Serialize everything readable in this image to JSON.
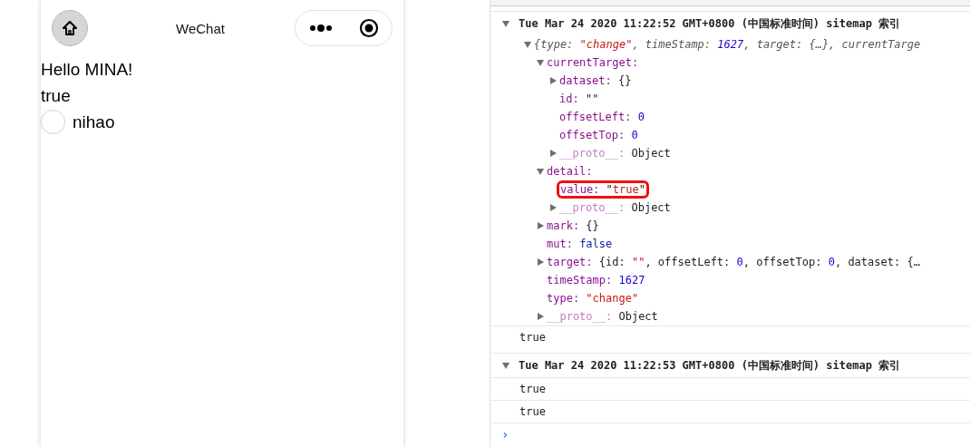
{
  "simulator": {
    "nav_bar": {
      "title": "WeChat"
    },
    "content": [
      {
        "kind": "text",
        "text": "Hello MINA!"
      },
      {
        "kind": "text",
        "text": "true"
      },
      {
        "kind": "radio",
        "label": "nihao",
        "checked": false
      }
    ]
  },
  "console": {
    "entries": [
      {
        "kind": "group",
        "expanded": true,
        "text": "Tue Mar 24 2020 11:22:52 GMT+0800 (中国标准时间) sitemap 索引",
        "children": [
          {
            "kind": "object",
            "expanded": true,
            "tokens": [
              {
                "kind": "plain",
                "text": "{type: "
              },
              {
                "kind": "string",
                "text": "\"change\""
              },
              {
                "kind": "plain",
                "text": ", timeStamp: "
              },
              {
                "kind": "number",
                "text": "1627"
              },
              {
                "kind": "plain",
                "text": ", target: {…}, currentTarge"
              }
            ],
            "children": [
              {
                "expanded": true,
                "tokens": [
                  {
                    "kind": "key",
                    "text": "currentTarget:"
                  }
                ],
                "children": [
                  {
                    "expanded": false,
                    "tokens": [
                      {
                        "kind": "key",
                        "text": "dataset:"
                      },
                      {
                        "kind": "plain",
                        "text": " {}"
                      }
                    ]
                  },
                  {
                    "tokens": [
                      {
                        "kind": "key",
                        "text": "id:"
                      },
                      {
                        "kind": "plain",
                        "text": " \"\""
                      }
                    ]
                  },
                  {
                    "tokens": [
                      {
                        "kind": "key",
                        "text": "offsetLeft:"
                      },
                      {
                        "kind": "number",
                        "text": " 0"
                      }
                    ]
                  },
                  {
                    "tokens": [
                      {
                        "kind": "key",
                        "text": "offsetTop:"
                      },
                      {
                        "kind": "number",
                        "text": " 0"
                      }
                    ]
                  },
                  {
                    "expanded": false,
                    "tokens": [
                      {
                        "kind": "proto",
                        "text": "__proto__:"
                      },
                      {
                        "kind": "plain",
                        "text": " Object"
                      }
                    ]
                  }
                ]
              },
              {
                "expanded": true,
                "tokens": [
                  {
                    "kind": "key",
                    "text": "detail:"
                  }
                ],
                "children": [
                  {
                    "highlighted": true,
                    "tokens": [
                      {
                        "kind": "key",
                        "text": "value:"
                      },
                      {
                        "kind": "plain",
                        "text": " \""
                      },
                      {
                        "kind": "string",
                        "text": "true"
                      },
                      {
                        "kind": "plain",
                        "text": "\""
                      }
                    ]
                  },
                  {
                    "expanded": false,
                    "tokens": [
                      {
                        "kind": "proto",
                        "text": "__proto__:"
                      },
                      {
                        "kind": "plain",
                        "text": " Object"
                      }
                    ]
                  }
                ]
              },
              {
                "expanded": false,
                "tokens": [
                  {
                    "kind": "key",
                    "text": "mark:"
                  },
                  {
                    "kind": "plain",
                    "text": " {}"
                  }
                ]
              },
              {
                "tokens": [
                  {
                    "kind": "key",
                    "text": "mut:"
                  },
                  {
                    "kind": "keyword",
                    "text": " false"
                  }
                ]
              },
              {
                "expanded": false,
                "tokens": [
                  {
                    "kind": "key",
                    "text": "target:"
                  },
                  {
                    "kind": "plain",
                    "text": " {id: "
                  },
                  {
                    "kind": "string",
                    "text": "\"\""
                  },
                  {
                    "kind": "plain",
                    "text": ", offsetLeft: "
                  },
                  {
                    "kind": "number",
                    "text": "0"
                  },
                  {
                    "kind": "plain",
                    "text": ", offsetTop: "
                  },
                  {
                    "kind": "number",
                    "text": "0"
                  },
                  {
                    "kind": "plain",
                    "text": ", dataset: {…"
                  }
                ]
              },
              {
                "tokens": [
                  {
                    "kind": "key",
                    "text": "timeStamp:"
                  },
                  {
                    "kind": "number",
                    "text": " 1627"
                  }
                ]
              },
              {
                "tokens": [
                  {
                    "kind": "key",
                    "text": "type:"
                  },
                  {
                    "kind": "string",
                    "text": " \"change\""
                  }
                ]
              },
              {
                "expanded": false,
                "tokens": [
                  {
                    "kind": "proto",
                    "text": "__proto__:"
                  },
                  {
                    "kind": "plain",
                    "text": " Object"
                  }
                ]
              }
            ]
          }
        ]
      },
      {
        "kind": "log",
        "text": "true"
      },
      {
        "kind": "group",
        "expanded": true,
        "text": "Tue Mar 24 2020 11:22:53 GMT+0800 (中国标准时间) sitemap 索引",
        "children": [
          {
            "kind": "log",
            "text": "true"
          },
          {
            "kind": "log",
            "text": "true"
          }
        ]
      }
    ],
    "prompt": "›"
  }
}
